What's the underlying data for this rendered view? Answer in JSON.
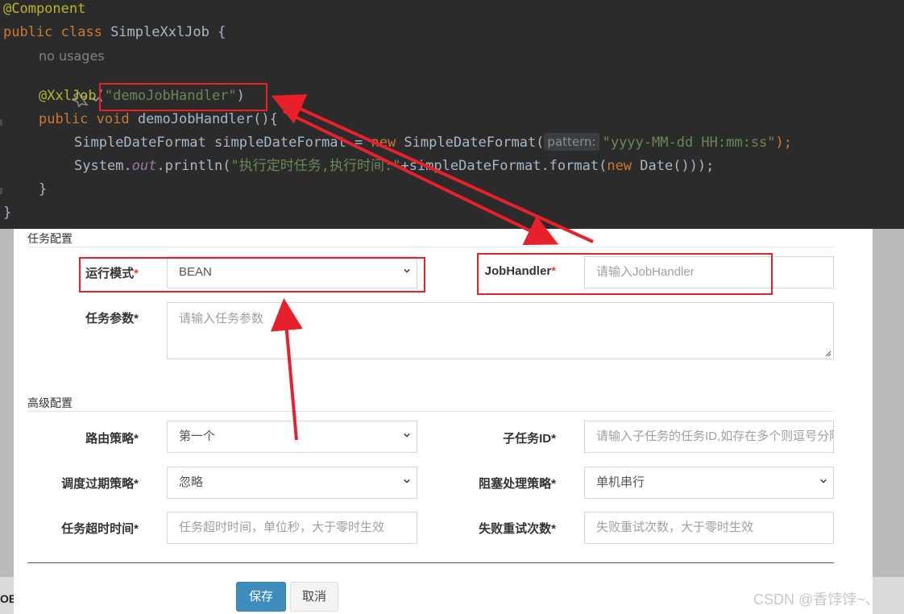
{
  "code": {
    "line1": "@Component",
    "line2_kw": "public class",
    "line2_name": " SimpleXxlJob {",
    "usages": "no usages",
    "line4_ann": "@XxlJob",
    "line4_open": "(",
    "line4_str": "\"demoJobHandler\"",
    "line4_close": ")",
    "line5_kw": "public void",
    "line5_fn": " demoJobHandler",
    "line5_rest": "(){",
    "line6_a": "SimpleDateFormat simpleDateFormat = ",
    "line6_new": "new",
    "line6_b": " SimpleDateFormat(",
    "line6_hint": "pattern:",
    "line6_str": "\"yyyy-MM-dd HH:mm:ss\"",
    "line6_c": ");",
    "line7_a": "System.",
    "line7_out": "out",
    "line7_b": ".println(",
    "line7_str": "\"执行定时任务,执行时间:\"",
    "line7_c": "+simpleDateFormat.format(",
    "line7_new": "new",
    "line7_d": " Date()));",
    "line8": "}",
    "line9": "}"
  },
  "form": {
    "section_task": "任务配置",
    "section_advanced": "高级配置",
    "run_mode_label": "运行模式",
    "run_mode_value": "BEAN",
    "jobhandler_label": "JobHandler",
    "jobhandler_placeholder": "请输入JobHandler",
    "params_label": "任务参数",
    "params_placeholder": "请输入任务参数",
    "route_label": "路由策略",
    "route_value": "第一个",
    "child_label": "子任务ID",
    "child_placeholder": "请输入子任务的任务ID,如存在多个则逗号分隔",
    "misfire_label": "调度过期策略",
    "misfire_value": "忽略",
    "block_label": "阻塞处理策略",
    "block_value": "单机串行",
    "timeout_label": "任务超时时间",
    "timeout_placeholder": "任务超时时间，单位秒，大于零时生效",
    "retry_label": "失败重试次数",
    "retry_placeholder": "失败重试次数，大于零时生效",
    "required_mark": "*",
    "save_label": "保存",
    "cancel_label": "取消"
  },
  "background": {
    "left_fragment": "OB"
  },
  "watermark": "CSDN @香饽饽~、",
  "colors": {
    "annotation_red": "#e8202a",
    "save_blue": "#3c8dbc"
  }
}
